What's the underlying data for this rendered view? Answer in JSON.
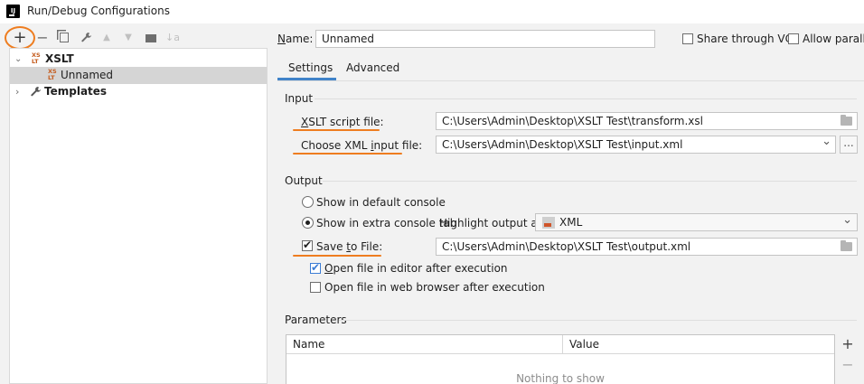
{
  "window": {
    "title": "Run/Debug Configurations",
    "app_icon_letter": "IJ"
  },
  "toolbar": {
    "add": "+",
    "remove": "−",
    "copy": "⧉",
    "edit": "🔧",
    "up": "▲",
    "down": "▼",
    "folder": "📁",
    "sort": "↓a"
  },
  "tree": {
    "items": [
      {
        "label": "XSLT",
        "icon": "xslt-icon",
        "expanded": true
      },
      {
        "label": "Unnamed",
        "icon": "xslt-icon",
        "selected": true
      },
      {
        "label": "Templates",
        "icon": "wrench-icon",
        "expanded": false
      }
    ],
    "xslt_icon_text": {
      "top": "XS",
      "bottom": "LT"
    }
  },
  "header": {
    "name_label": "Name:",
    "name_value": "Unnamed",
    "share_label": "Share through VCS",
    "allow_parallel_label": "Allow parallel r"
  },
  "tabs": [
    {
      "label": "Settings",
      "active": true
    },
    {
      "label": "Advanced",
      "active": false
    }
  ],
  "input_section": {
    "title": "Input",
    "xslt_label": "XSLT script file:",
    "xslt_value": "C:\\Users\\Admin\\Desktop\\XSLT Test\\transform.xsl",
    "xml_label": "Choose XML input file:",
    "xml_value": "C:\\Users\\Admin\\Desktop\\XSLT Test\\input.xml",
    "ellipsis": "...",
    "dropdown_arrow": "⌄"
  },
  "output_section": {
    "title": "Output",
    "radio_default": "Show in default console",
    "radio_extra": "Show in extra console tab",
    "highlight_label": "Highlight output as:",
    "highlight_value": "XML",
    "save_label": "Save to File:",
    "save_value": "C:\\Users\\Admin\\Desktop\\XSLT Test\\output.xml",
    "open_editor": "Open file in editor after execution",
    "open_browser": "Open file in web browser after execution"
  },
  "parameters": {
    "title": "Parameters",
    "columns": [
      "Name",
      "Value"
    ],
    "empty_text": "Nothing to show",
    "add": "+",
    "remove": "−"
  },
  "colors": {
    "accent_blue": "#4083c9",
    "annotation_orange": "#ee7d20",
    "selection": "#d5d5d5"
  }
}
